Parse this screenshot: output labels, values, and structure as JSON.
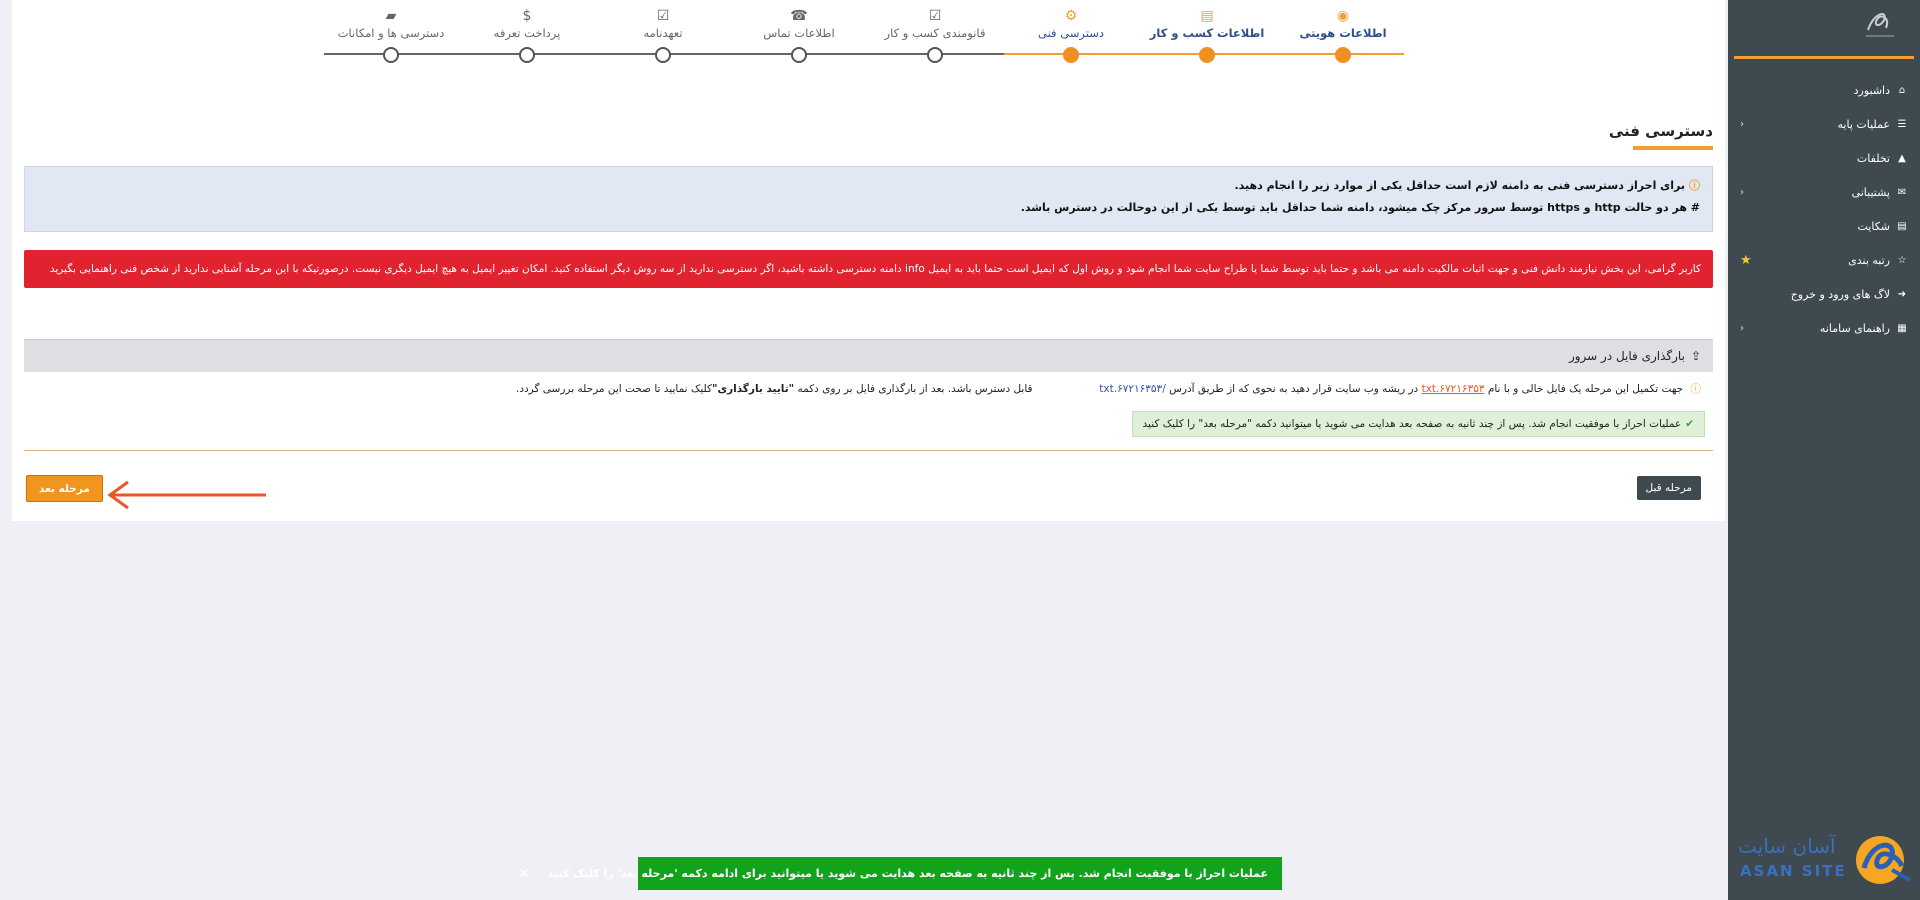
{
  "sidebar": {
    "items": [
      {
        "icon": "home-icon",
        "glyph": "⌂",
        "label": "داشبورد",
        "chevron": ""
      },
      {
        "icon": "list-icon",
        "glyph": "☰",
        "label": "عملیات پایه",
        "chevron": "‹"
      },
      {
        "icon": "warning-icon",
        "glyph": "▲",
        "label": "تخلفات",
        "chevron": ""
      },
      {
        "icon": "chat-icon",
        "glyph": "✉",
        "label": "پشتیبانی",
        "chevron": "‹"
      },
      {
        "icon": "file-icon",
        "glyph": "▤",
        "label": "شکایت",
        "chevron": ""
      },
      {
        "icon": "star-icon",
        "glyph": "☆",
        "label": "رتبه بندی",
        "chevron": ""
      },
      {
        "icon": "login-icon",
        "glyph": "➜",
        "label": "لاگ های ورود و خروج",
        "chevron": ""
      },
      {
        "icon": "guide-icon",
        "glyph": "▦",
        "label": "راهنمای سامانه",
        "chevron": "‹"
      }
    ],
    "brand_fa": "آسان سایت",
    "brand_en": "ASAN SITE"
  },
  "stepper": {
    "steps": [
      {
        "label": "اطلاعات هویتی",
        "glyph": "◉",
        "state": "done"
      },
      {
        "label": "اطلاعات کسب و کار",
        "glyph": "▤",
        "state": "done"
      },
      {
        "label": "دسترسی فنی",
        "glyph": "⚙",
        "state": "current"
      },
      {
        "label": "قانومندی کسب و کار",
        "glyph": "☑",
        "state": "todo"
      },
      {
        "label": "اطلاعات تماس",
        "glyph": "☎",
        "state": "todo"
      },
      {
        "label": "تعهدنامه",
        "glyph": "☑",
        "state": "todo"
      },
      {
        "label": "پرداخت تعرفه",
        "glyph": "$",
        "state": "todo"
      },
      {
        "label": "دسترسی ها و امکانات",
        "glyph": "▰",
        "state": "todo"
      }
    ]
  },
  "section": {
    "title": "دسترسی فنی"
  },
  "info_box": {
    "line1": "برای احراز دسترسی فنی به دامنه لازم است حداقل یکی از موارد زیر را انجام دهید.",
    "line2": "# هر دو حالت http و https توسط سرور مرکز چک میشود، دامنه شما حداقل باید توسط یکی از این دوحالت در دسترس باشد."
  },
  "alert": {
    "text": "کاربر گرامی، این بخش نیازمند دانش فنی و جهت اثبات مالکیت دامنه می باشد و حتما باید توسط شما یا طراح سایت شما انجام شود و روش اول که ایمیل است حتما باید به ایمیل info دامنه دسترسی داشته باشید، اگر دسترسی ندارید از سه روش دیگر استفاده کنید. امکان تغییر ایمیل به هیچ ایمیل دیگری نیست. درصورتیکه با این مرحله آشنایی ندارید از شخص فنی راهنمایی بگیرید"
  },
  "upload": {
    "header": "بارگذاری فایل در سرور",
    "instr_part1": "جهت تکمیل این مرحله یک فایل خالی و با نام",
    "file_name": "۶۷۲۱۶۳۵۳.txt",
    "instr_part2": "در ریشه وب سایت قرار دهید به نحوی که از طریق آدرس",
    "url": "/۶۷۲۱۶۳۵۳.txt",
    "instr_part3": "قابل دسترس باشد. بعد از بارگذاری فایل بر روی دکمه",
    "confirm_label": "\"تایید بارگذاری\"",
    "instr_part4": "کلیک نمایید تا صحت این مرحله بررسی گردد.",
    "success": "عملیات احراز با موفقیت انجام شد. پس از چند ثانیه به صفحه بعد هدایت می شوید یا میتوانید دکمه \"مرحله بعد\" را کلیک کنید"
  },
  "nav": {
    "prev_label": "مرحله قبل",
    "next_label": "مرحله بعد"
  },
  "toast": {
    "text": "عملیات احراز با موفقیت انجام شد. پس از چند ثانیه به صفحه بعد هدایت می شوید یا میتوانید برای ادامه دکمه 'مرحله بعد' را کلیک کنید",
    "close": "×"
  },
  "colors": {
    "accent": "#f0a030",
    "sidebar": "#3e4a4f",
    "alert": "#e0232f",
    "toast": "#11a31b"
  }
}
